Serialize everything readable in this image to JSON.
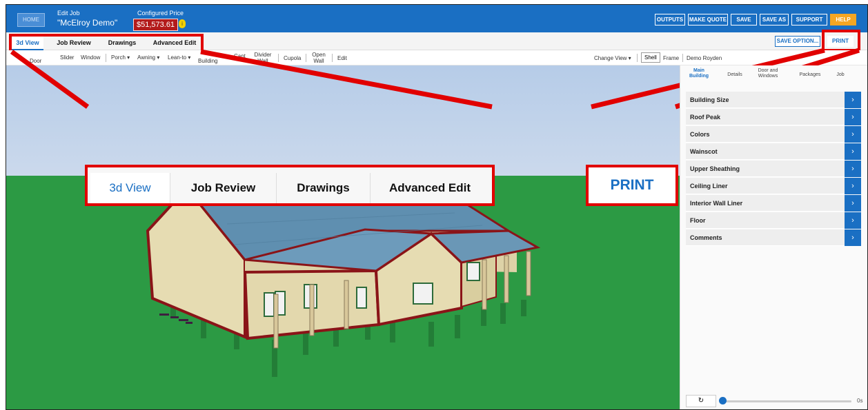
{
  "header": {
    "home_label": "HOME",
    "edit_job_label": "Edit Job",
    "job_name": "\"McElroy Demo\"",
    "price_label": "Configured Price",
    "price_value": "$51,573.61",
    "info_symbol": "i",
    "buttons": [
      {
        "label": "OUTPUTS"
      },
      {
        "label": "MAKE QUOTE"
      },
      {
        "label": "SAVE"
      },
      {
        "label": "SAVE AS"
      },
      {
        "label": "SUPPORT"
      },
      {
        "label": "HELP"
      }
    ],
    "brand_color": "#1a6fc3",
    "help_color": "#f5a623"
  },
  "tabs": [
    {
      "label": "3d View",
      "active": true
    },
    {
      "label": "Job Review"
    },
    {
      "label": "Drawings"
    },
    {
      "label": "Advanced Edit"
    }
  ],
  "save_option_label": "SAVE OPTION...",
  "print_label": "PRINT",
  "toolbar": {
    "items": [
      {
        "label": "Door"
      },
      {
        "label": "Slider"
      },
      {
        "label": "Window"
      },
      {
        "label": "Porch"
      },
      {
        "label": "Awning"
      },
      {
        "label": "Lean-to"
      },
      {
        "label": "Building"
      },
      {
        "label": "Cant"
      },
      {
        "label": "Divider Wall"
      },
      {
        "label": "Cupola"
      },
      {
        "label": "Open Wall"
      },
      {
        "label": "Edit"
      }
    ],
    "change_view": "Change View",
    "shell": "Shell",
    "frame": "Frame",
    "demo": "Demo Royden"
  },
  "panel": {
    "tabs": [
      {
        "label": "Main Building",
        "active": true
      },
      {
        "label": "Details"
      },
      {
        "label": "Door and Windows"
      },
      {
        "label": "Packages"
      },
      {
        "label": "Job"
      }
    ],
    "sections": [
      {
        "label": "Building Size"
      },
      {
        "label": "Roof Peak"
      },
      {
        "label": "Colors"
      },
      {
        "label": "Wainscot"
      },
      {
        "label": "Upper Sheathing"
      },
      {
        "label": "Ceiling Liner"
      },
      {
        "label": "Interior Wall Liner"
      },
      {
        "label": "Floor"
      },
      {
        "label": "Comments"
      }
    ],
    "refresh_symbol": "↻",
    "chevron": "›",
    "time_label": "0s",
    "slider_value": 0
  },
  "callouts": {
    "tabs": [
      {
        "label": "3d View",
        "active": true
      },
      {
        "label": "Job Review"
      },
      {
        "label": "Drawings"
      },
      {
        "label": "Advanced Edit"
      }
    ],
    "print_label": "PRINT",
    "color": "#e10000"
  },
  "scene": {
    "sky_color": "#b6cce8",
    "ground_color": "#2c9a44",
    "roof_color": "#5f8fb0",
    "wall_color": "#e6dcb2",
    "trim_color": "#8a1418"
  }
}
